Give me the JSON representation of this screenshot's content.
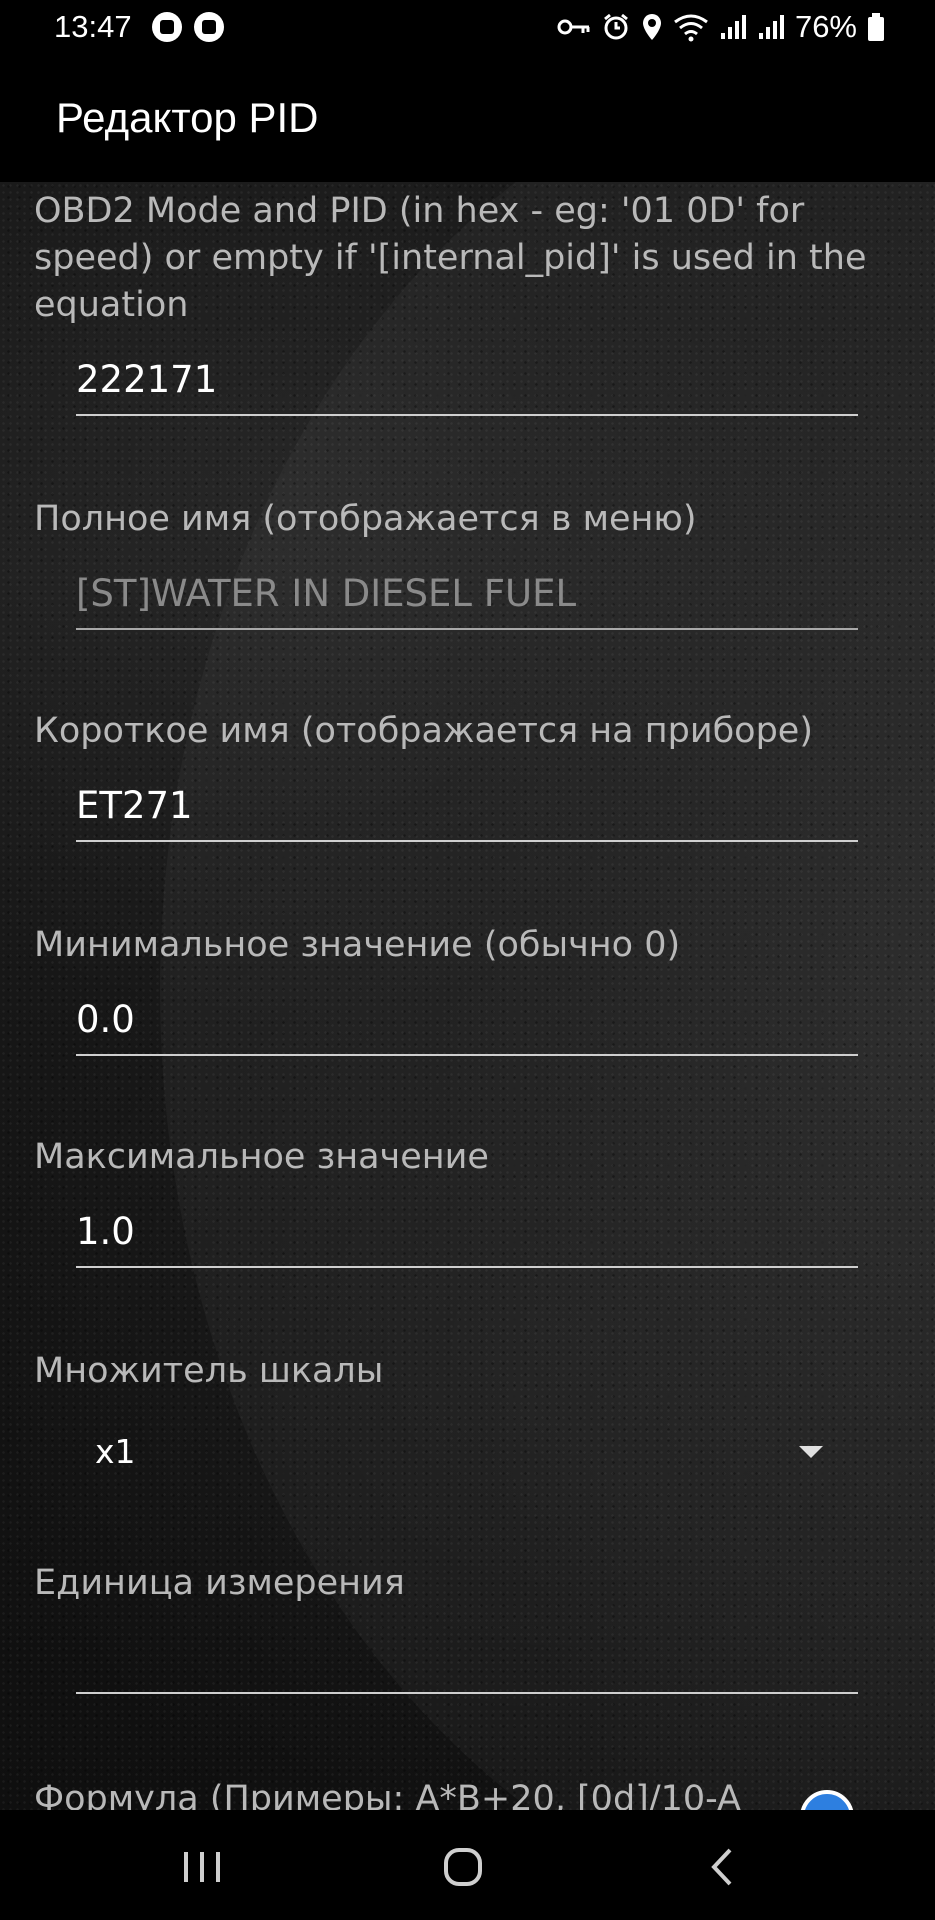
{
  "status_bar": {
    "time": "13:47",
    "battery": "76%"
  },
  "app_bar": {
    "title": "Редактор PID"
  },
  "form": {
    "pid_label": "OBD2 Mode and PID (in hex - eg: '01 0D' for speed) or empty if '[internal_pid]' is used in the equation",
    "pid_value": "222171",
    "full_name_label": "Полное имя (отображается в меню)",
    "full_name_value": "[ST]WATER IN DIESEL FUEL",
    "short_name_label": "Короткое имя (отображается на приборе)",
    "short_name_value": "ET271",
    "min_label": "Минимальное значение (обычно 0)",
    "min_value": "0.0",
    "max_label": "Максимальное значение",
    "max_value": "1.0",
    "scale_label": "Множитель шкалы",
    "scale_value": "x1",
    "unit_label": "Единица измерения",
    "unit_value": "",
    "formula_label": "Формула (Примеры: A*B+20, [0d]/10-A"
  },
  "icons": {
    "status_left": [
      "notification-icon",
      "notification-icon"
    ],
    "status_right": [
      "vpn-key-icon",
      "alarm-icon",
      "location-icon",
      "wifi-icon",
      "signal-icon",
      "signal-icon",
      "battery-icon"
    ],
    "nav": [
      "recents-icon",
      "home-icon",
      "back-icon"
    ]
  }
}
